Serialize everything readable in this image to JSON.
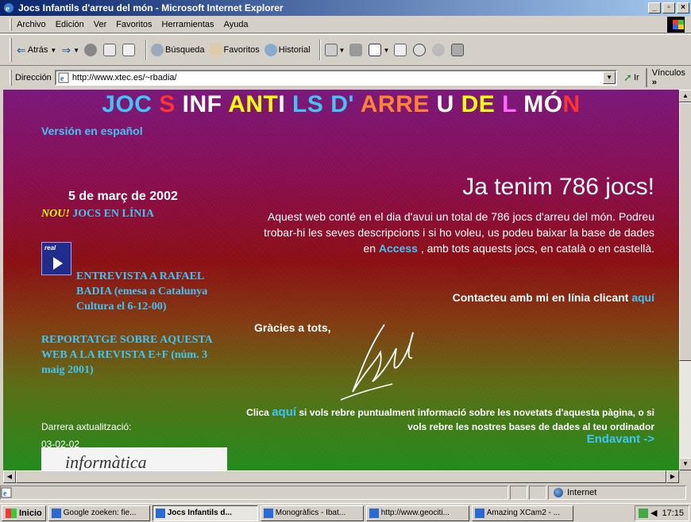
{
  "window": {
    "title": "Jocs Infantils d'arreu del món - Microsoft Internet Explorer"
  },
  "menu": [
    "Archivo",
    "Edición",
    "Ver",
    "Favoritos",
    "Herramientas",
    "Ayuda"
  ],
  "toolbar": {
    "back": "Atrás",
    "search": "Búsqueda",
    "favorites": "Favoritos",
    "history": "Historial"
  },
  "address": {
    "label": "Dirección",
    "url": "http://www.xtec.es/~rbadia/",
    "go": "Ir",
    "links": "Vínculos"
  },
  "page": {
    "title_parts": [
      {
        "text": "JOC ",
        "color": "#3ec4f4"
      },
      {
        "text": "S ",
        "color": "#ff3030"
      },
      {
        "text": "INF ",
        "color": "#ffffff"
      },
      {
        "text": "ANT",
        "color": "#ffff00"
      },
      {
        "text": "I ",
        "color": "#ffffff"
      },
      {
        "text": "LS D' ",
        "color": "#3ec4f4"
      },
      {
        "text": "ARRE ",
        "color": "#ff8030"
      },
      {
        "text": "U ",
        "color": "#ffffff"
      },
      {
        "text": "DE ",
        "color": "#ffff00"
      },
      {
        "text": "L ",
        "color": "#ff66ff"
      },
      {
        "text": "MÓ",
        "color": "#ffffff"
      },
      {
        "text": "N",
        "color": "#ff3030"
      }
    ],
    "spanish_link": "Versión en español",
    "date": "5 de març de 2002",
    "new_label": "NOU!",
    "online_link": "JOCS EN LÍNIA",
    "interview_link": "ENTREVISTA A RAFAEL BADIA (emesa a Catalunya Cultura el 6-12-00)",
    "report_link": "REPORTATGE SOBRE AQUESTA WEB A LA REVISTA E+F (núm. 3 maig 2001)",
    "last_update_label": "Darrera axtualització:",
    "last_update_date": "03-02-02",
    "banner_text": "informàtica",
    "real_icon_text": "real",
    "headline": "Ja tenim 786 jocs!",
    "intro_before": "Aquest web conté en el dia d'avui un total de 786 jocs d'arreu del món.  Podreu trobar-hi les seves descripcions i si ho voleu, us podeu baixar la base de dades en ",
    "intro_keyword": "Access",
    "intro_after": " , amb tots aquests jocs, en català o en castellà.",
    "contact_text": "Contacteu amb mi en línia clicant ",
    "here": "aquí",
    "thanks": "Gràcies a tots,",
    "subscribe_before": "Clica ",
    "subscribe_after": " si vols rebre puntualment informació sobre les novetats d'aquesta pàgina, o si vols rebre les nostres bases de dades al teu ordinador",
    "forward": "Endavant ->"
  },
  "status": {
    "zone": "Internet"
  },
  "taskbar": {
    "start": "Inicio",
    "tasks": [
      "Google zoeken: fie...",
      "Jocs Infantils d...",
      "Monogràfics - Ibat...",
      "http://www.geociti...",
      "Amazing XCam2 - ..."
    ],
    "clock": "17:15"
  }
}
